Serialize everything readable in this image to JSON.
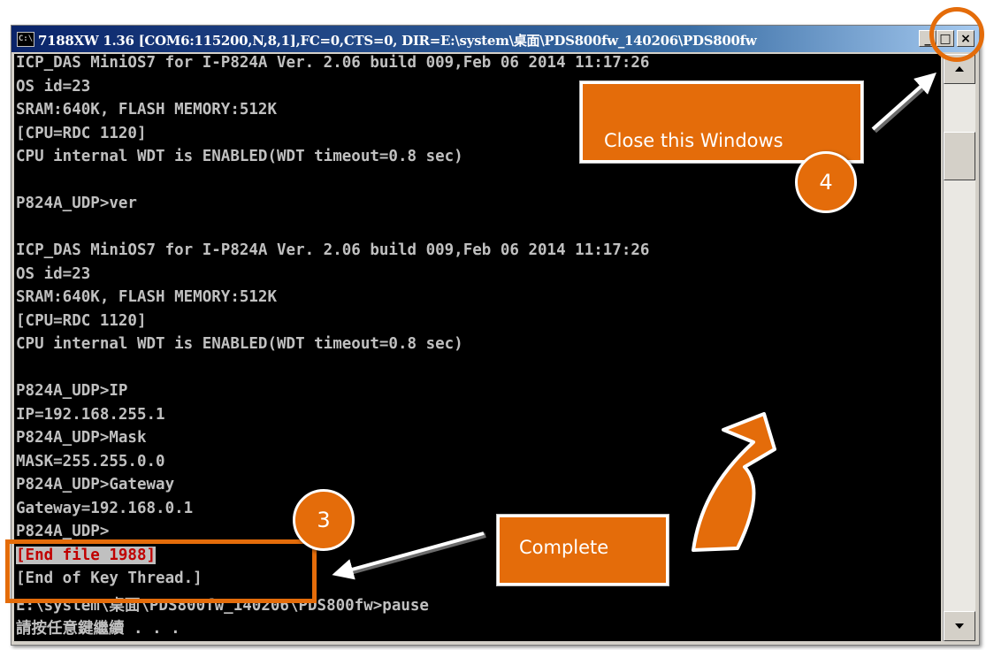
{
  "window": {
    "icon_text": "C:\\",
    "title": "7188XW 1.36 [COM6:115200,N,8,1],FC=0,CTS=0, DIR=E:\\system\\桌面\\PDS800fw_140206\\PDS800fw",
    "buttons": {
      "minimize": "_",
      "maximize": "□",
      "close": "×"
    }
  },
  "console": {
    "lines": [
      "ICP_DAS MiniOS7 for I-P824A Ver. 2.06 build 009,Feb 06 2014 11:17:26",
      "OS id=23",
      "SRAM:640K, FLASH MEMORY:512K",
      "[CPU=RDC 1120]",
      "CPU internal WDT is ENABLED(WDT timeout=0.8 sec)",
      "",
      "P824A_UDP>ver",
      "",
      "ICP_DAS MiniOS7 for I-P824A Ver. 2.06 build 009,Feb 06 2014 11:17:26",
      "OS id=23",
      "SRAM:640K, FLASH MEMORY:512K",
      "[CPU=RDC 1120]",
      "CPU internal WDT is ENABLED(WDT timeout=0.8 sec)",
      "",
      "P824A_UDP>IP",
      "IP=192.168.255.1",
      "P824A_UDP>Mask",
      "MASK=255.255.0.0",
      "P824A_UDP>Gateway",
      "Gateway=192.168.0.1",
      "P824A_UDP>",
      "[End file 1988]",
      "[End of Key Thread.]",
      "E:\\system\\桌面\\PDS800fw_140206\\PDS800fw>pause",
      "請按任意鍵繼續 . . ."
    ]
  },
  "annotations": {
    "close_label": "Close this Windows",
    "step_4": "4",
    "complete_label": "Complete",
    "step_3": "3",
    "colors": {
      "accent": "#e46c0a"
    }
  }
}
